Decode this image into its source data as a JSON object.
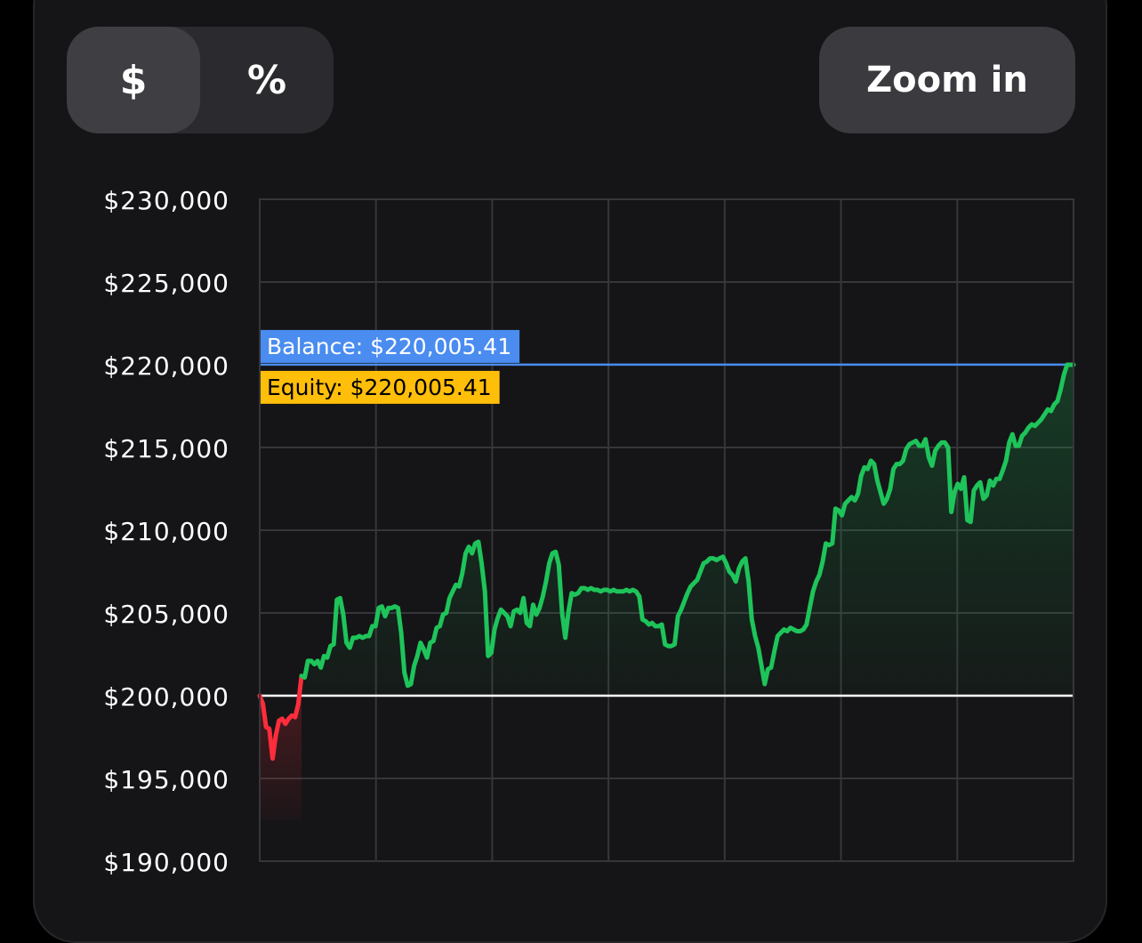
{
  "controls": {
    "dollar_label": "$",
    "percent_label": "%",
    "zoom_label": "Zoom in"
  },
  "colors": {
    "profit_line": "#1ec45a",
    "loss_line": "#ff2d3c",
    "balance_line": "#4a8cf0",
    "balance_label_bg": "#4a8cf0",
    "equity_label_bg": "#ffbe0a",
    "baseline": "#ffffff",
    "grid": "#36363a"
  },
  "chart_data": {
    "type": "line",
    "title": "",
    "ylim": [
      190000,
      230000
    ],
    "y_ticks": [
      {
        "value": 230000,
        "label": "$230,000"
      },
      {
        "value": 225000,
        "label": "$225,000"
      },
      {
        "value": 220000,
        "label": "$220,000"
      },
      {
        "value": 215000,
        "label": "$215,000"
      },
      {
        "value": 210000,
        "label": "$210,000"
      },
      {
        "value": 205000,
        "label": "$205,000"
      },
      {
        "value": 200000,
        "label": "$200,000"
      },
      {
        "value": 195000,
        "label": "$195,000"
      },
      {
        "value": 190000,
        "label": "$190,000"
      }
    ],
    "vertical_gridlines": 6,
    "grid": true,
    "starting_balance": 200000,
    "balance": {
      "value": 220005.41,
      "label": "Balance: $220,005.41"
    },
    "equity": {
      "value": 220005.41,
      "label": "Equity: $220,005.41"
    },
    "series": [
      {
        "values": [
          200000,
          199500,
          198100,
          198000,
          196200,
          197600,
          198500,
          198600,
          198300,
          198600,
          198800,
          198700,
          199500,
          201200,
          201100,
          202100,
          202100,
          201900,
          202100,
          201700,
          202400,
          202300,
          203000,
          203100,
          205800,
          205900,
          204900,
          203200,
          202900,
          203500,
          203500,
          203600,
          203500,
          203600,
          203600,
          204200,
          204200,
          205300,
          205400,
          204800,
          205300,
          205300,
          205400,
          205300,
          203800,
          201400,
          200600,
          200700,
          201800,
          202400,
          203200,
          202800,
          202300,
          203200,
          203300,
          204100,
          204200,
          204900,
          205000,
          205900,
          206300,
          206700,
          206600,
          207400,
          208600,
          209000,
          208600,
          209200,
          209300,
          208000,
          206300,
          202400,
          202600,
          204000,
          204700,
          205200,
          205000,
          204800,
          204200,
          205100,
          205200,
          205000,
          205900,
          204400,
          204200,
          205500,
          204900,
          205300,
          206000,
          206900,
          208000,
          208600,
          208700,
          207900,
          205000,
          203500,
          205100,
          206200,
          206100,
          206200,
          206500,
          206500,
          206400,
          206500,
          206400,
          206400,
          206300,
          206400,
          206400,
          206300,
          206400,
          206300,
          206300,
          206300,
          206400,
          206300,
          206400,
          206300,
          206000,
          204600,
          204500,
          204300,
          204400,
          204200,
          204200,
          204300,
          203100,
          203000,
          203000,
          203100,
          204800,
          205200,
          205700,
          206200,
          206600,
          206800,
          207000,
          207500,
          208000,
          208100,
          208300,
          208300,
          208200,
          208300,
          208400,
          208000,
          207500,
          207300,
          206900,
          207700,
          208100,
          208300,
          206900,
          204600,
          203600,
          202900,
          201800,
          200700,
          201600,
          201700,
          202700,
          203600,
          203800,
          204000,
          203900,
          204100,
          204000,
          203900,
          203900,
          204000,
          204300,
          205300,
          206300,
          206900,
          207300,
          208100,
          209200,
          209100,
          209200,
          211300,
          211200,
          210900,
          211600,
          211800,
          212000,
          211800,
          212200,
          213300,
          213800,
          213700,
          214200,
          214000,
          213000,
          212300,
          211600,
          211900,
          212500,
          213700,
          214000,
          214000,
          214200,
          214900,
          215200,
          215300,
          215400,
          215100,
          215100,
          215500,
          214400,
          213900,
          214800,
          215100,
          215300,
          215300,
          215000,
          211100,
          212300,
          212800,
          212500,
          213200,
          210600,
          210500,
          212400,
          212700,
          212900,
          211900,
          212100,
          213000,
          212700,
          213100,
          213100,
          213600,
          214200,
          215300,
          215800,
          215100,
          215100,
          215700,
          215900,
          216200,
          216400,
          216300,
          216500,
          216700,
          217000,
          217300,
          217200,
          217600,
          217800,
          218500,
          219400,
          220000,
          220000,
          220000
        ]
      }
    ]
  }
}
